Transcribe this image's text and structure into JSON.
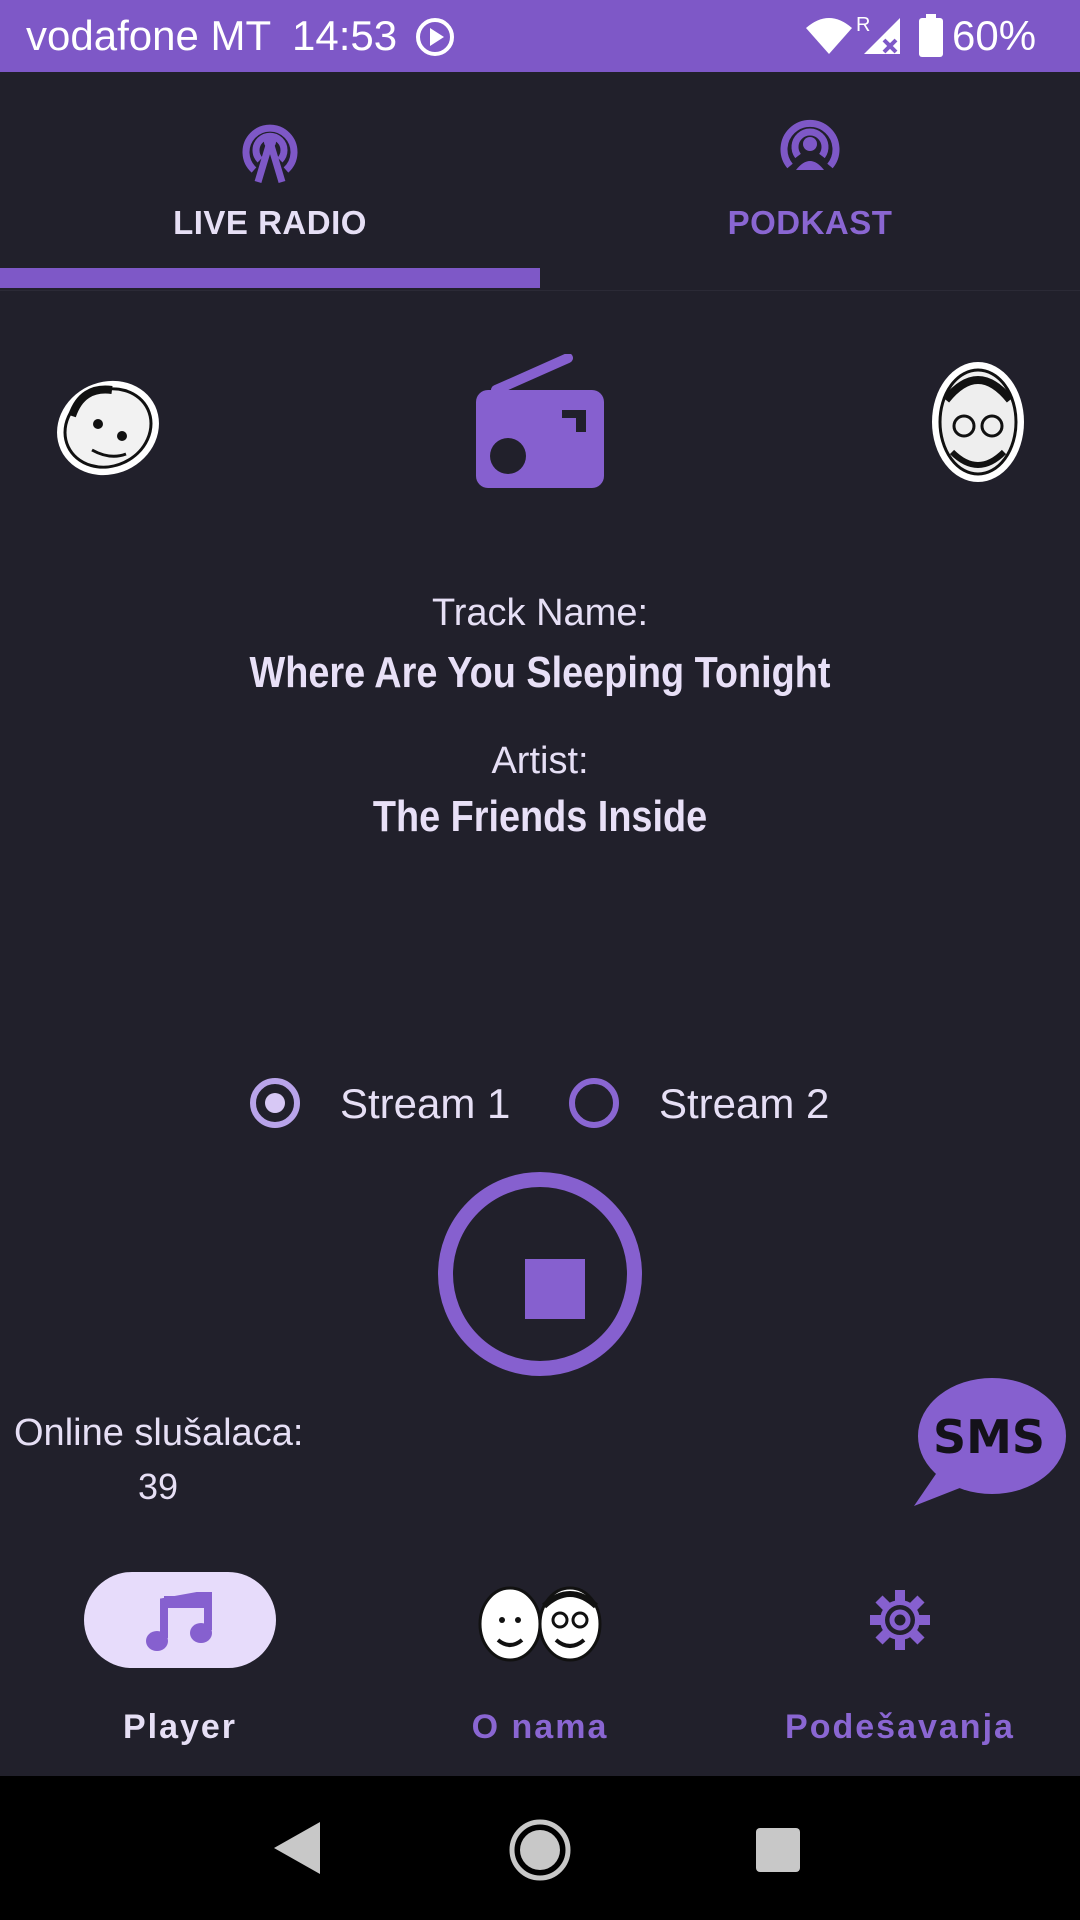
{
  "status_bar": {
    "carrier": "vodafone MT",
    "time": "14:53",
    "roaming": "R",
    "battery": "60%"
  },
  "tabs": [
    {
      "label": "LIVE RADIO",
      "icon": "radio-tower-icon",
      "selected": true
    },
    {
      "label": "PODKAST",
      "icon": "podcast-icon",
      "selected": false
    }
  ],
  "now_playing": {
    "track_label": "Track Name:",
    "track_name": "Where Are You Sleeping Tonight",
    "artist_label": "Artist:",
    "artist_name": "The Friends Inside"
  },
  "streams": [
    {
      "label": "Stream 1",
      "selected": true
    },
    {
      "label": "Stream 2",
      "selected": false
    }
  ],
  "listeners": {
    "label": "Online slušalaca:",
    "count": "39"
  },
  "sms_button": {
    "text": "SMS"
  },
  "bottom_nav": [
    {
      "label": "Player",
      "icon": "music-note-icon",
      "selected": true
    },
    {
      "label": "O nama",
      "icon": "hosts-avatars-icon",
      "selected": false
    },
    {
      "label": "Podešavanja",
      "icon": "gear-icon",
      "selected": false
    }
  ],
  "colors": {
    "accent": "#7e58c7",
    "background": "#21202b",
    "text": "#e6dff5",
    "pill": "#e7dcfb"
  }
}
